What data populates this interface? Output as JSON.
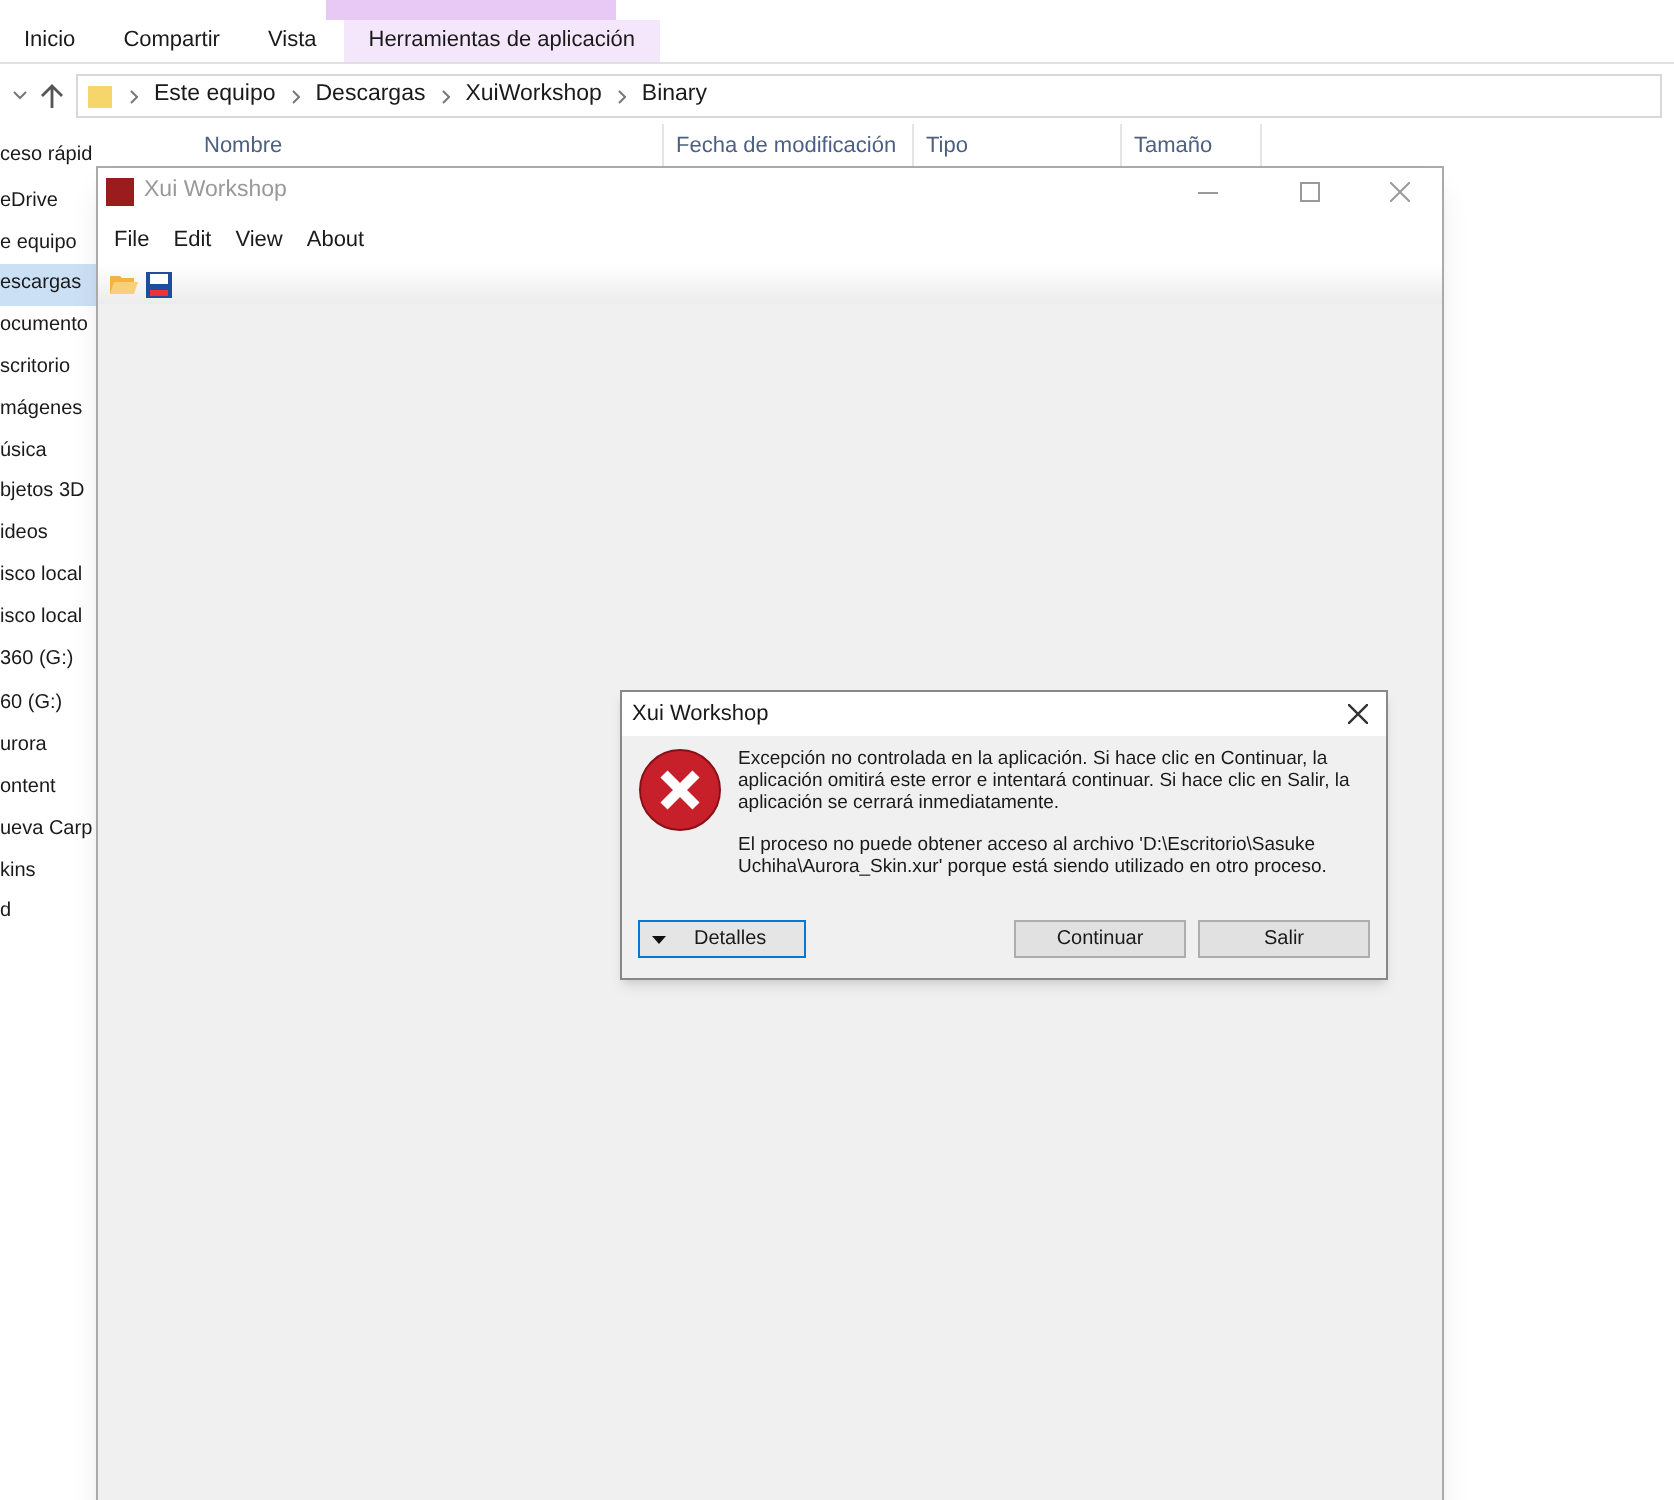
{
  "explorer": {
    "tabs": [
      {
        "label": "Inicio",
        "selected": false
      },
      {
        "label": "Compartir",
        "selected": false
      },
      {
        "label": "Vista",
        "selected": false
      },
      {
        "label": "Herramientas de aplicación",
        "selected": true
      }
    ],
    "breadcrumb": [
      "Este equipo",
      "Descargas",
      "XuiWorkshop",
      "Binary"
    ],
    "columns": [
      "Nombre",
      "Fecha de modificación",
      "Tipo",
      "Tamaño"
    ],
    "sidebar": [
      {
        "label": "ceso rápid",
        "selected": false
      },
      {
        "label": "eDrive",
        "selected": false
      },
      {
        "label": "e equipo",
        "selected": false
      },
      {
        "label": "escargas",
        "selected": true
      },
      {
        "label": "ocumento",
        "selected": false
      },
      {
        "label": "scritorio",
        "selected": false
      },
      {
        "label": "mágenes",
        "selected": false
      },
      {
        "label": "úsica",
        "selected": false
      },
      {
        "label": "bjetos 3D",
        "selected": false
      },
      {
        "label": "ideos",
        "selected": false
      },
      {
        "label": "isco local",
        "selected": false
      },
      {
        "label": "isco local",
        "selected": false
      },
      {
        "label": "360 (G:)",
        "selected": false
      },
      {
        "label": "60 (G:)",
        "selected": false
      },
      {
        "label": "urora",
        "selected": false
      },
      {
        "label": "ontent",
        "selected": false
      },
      {
        "label": "ueva Carp",
        "selected": false
      },
      {
        "label": "kins",
        "selected": false
      },
      {
        "label": "d",
        "selected": false
      }
    ]
  },
  "app": {
    "title": "Xui Workshop",
    "menu": [
      "File",
      "Edit",
      "View",
      "About"
    ]
  },
  "dialog": {
    "title": "Xui Workshop",
    "message": "Excepción no controlada en la aplicación. Si hace clic en Continuar, la aplicación omitirá este error e intentará continuar. Si hace clic en Salir, la aplicación se cerrará inmediatamente.",
    "detail": "El proceso no puede obtener acceso al archivo 'D:\\Escritorio\\Sasuke Uchiha\\Aurora_Skin.xur' porque está siendo utilizado en otro proceso.",
    "details_button": "Detalles",
    "buttons": [
      "Continuar",
      "Salir"
    ]
  }
}
